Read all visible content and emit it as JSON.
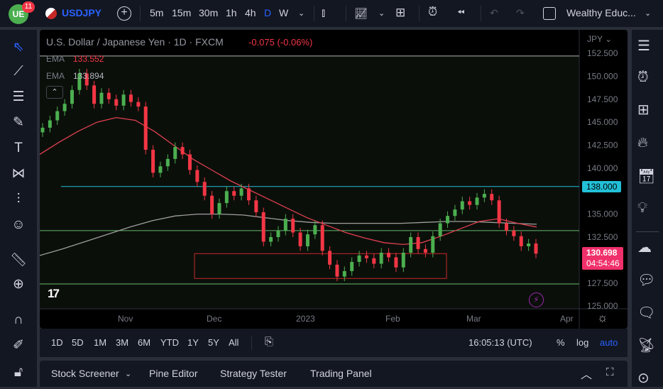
{
  "topbar": {
    "badge": "11",
    "symbol": "USDJPY",
    "intervals": [
      "5m",
      "15m",
      "30m",
      "1h",
      "4h",
      "D",
      "W"
    ],
    "active_interval": "D",
    "layout_name": "Wealthy Educ..."
  },
  "legend": {
    "title": "U.S. Dollar / Japanese Yen · 1D · FXCM",
    "change": "-0.075 (-0.06%)",
    "ema1_label": "EMA",
    "ema1_value": "133.552",
    "ema2_label": "EMA",
    "ema2_value": "133.894"
  },
  "colors": {
    "accent": "#2962ff",
    "up": "#26a69a",
    "down": "#ef5350",
    "candle_up": "#4caf50",
    "candle_down": "#f23645",
    "ema_fast": "#e04050",
    "ema_slow": "#9e9e9e",
    "level_cyan": "#22c0d8",
    "price_label": "#f0306a"
  },
  "chart_data": {
    "type": "candlestick",
    "currency": "JPY",
    "y_ticks": [
      "152.500",
      "150.000",
      "147.500",
      "145.000",
      "142.500",
      "140.000",
      "135.000",
      "132.500",
      "127.500",
      "125.000"
    ],
    "ylim": [
      125,
      152.5
    ],
    "x_ticks": [
      "Nov",
      "Dec",
      "2023",
      "Feb",
      "Mar",
      "Apr"
    ],
    "closes": [
      144.4,
      145.2,
      146.2,
      147.0,
      148.5,
      150.3,
      149.0,
      147.0,
      148.2,
      147.5,
      146.8,
      148.0,
      147.2,
      146.7,
      142.0,
      139.5,
      140.2,
      141.0,
      142.3,
      141.5,
      139.8,
      138.5,
      137.0,
      135.0,
      136.2,
      137.5,
      137.0,
      137.8,
      136.5,
      135.2,
      132.0,
      132.5,
      133.2,
      134.5,
      133.0,
      131.5,
      132.8,
      133.8,
      131.0,
      129.5,
      128.2,
      128.8,
      129.8,
      130.5,
      130.2,
      129.6,
      130.8,
      130.3,
      129.2,
      130.8,
      132.5,
      131.2,
      130.8,
      132.6,
      134.0,
      134.8,
      135.5,
      136.4,
      136.0,
      136.8,
      137.2,
      136.5,
      134.0,
      133.2,
      132.6,
      131.5,
      131.8,
      130.7
    ],
    "ema_fast": [
      141.5,
      142.8,
      144.0,
      145.0,
      145.5,
      145.2,
      144.0,
      142.5,
      141.0,
      139.8,
      138.6,
      137.6,
      136.6,
      135.6,
      134.6,
      133.8,
      133.0,
      132.4,
      131.9,
      131.7,
      131.9,
      132.6,
      133.4,
      134.2,
      134.5,
      134.0,
      133.6
    ],
    "ema_slow": [
      130.5,
      131.2,
      132.0,
      132.8,
      133.6,
      134.3,
      134.8,
      135.0,
      135.0,
      134.9,
      134.6,
      134.3,
      134.1,
      134.0,
      134.0,
      134.0,
      134.0,
      134.1,
      134.2,
      134.2,
      134.1,
      134.0,
      133.9
    ],
    "levels": [
      {
        "price": "138.000",
        "color": "#22c0d8"
      },
      {
        "price": 133.2,
        "color": "#66bb6a"
      },
      {
        "price": 127.4,
        "color": "#66bb6a"
      },
      {
        "price": 152.2,
        "color": "#b0b3b8"
      }
    ],
    "zone": {
      "top": 130.7,
      "bottom": 128.0
    },
    "last_price": "130.698",
    "countdown": "04:54:46"
  },
  "range": {
    "buttons": [
      "1D",
      "5D",
      "1M",
      "3M",
      "6M",
      "YTD",
      "1Y",
      "5Y",
      "All"
    ],
    "time": "16:05:13 (UTC)",
    "percent": "%",
    "log": "log",
    "auto": "auto"
  },
  "bottom": {
    "tabs": [
      "Stock Screener",
      "Pine Editor",
      "Strategy Tester",
      "Trading Panel"
    ]
  }
}
